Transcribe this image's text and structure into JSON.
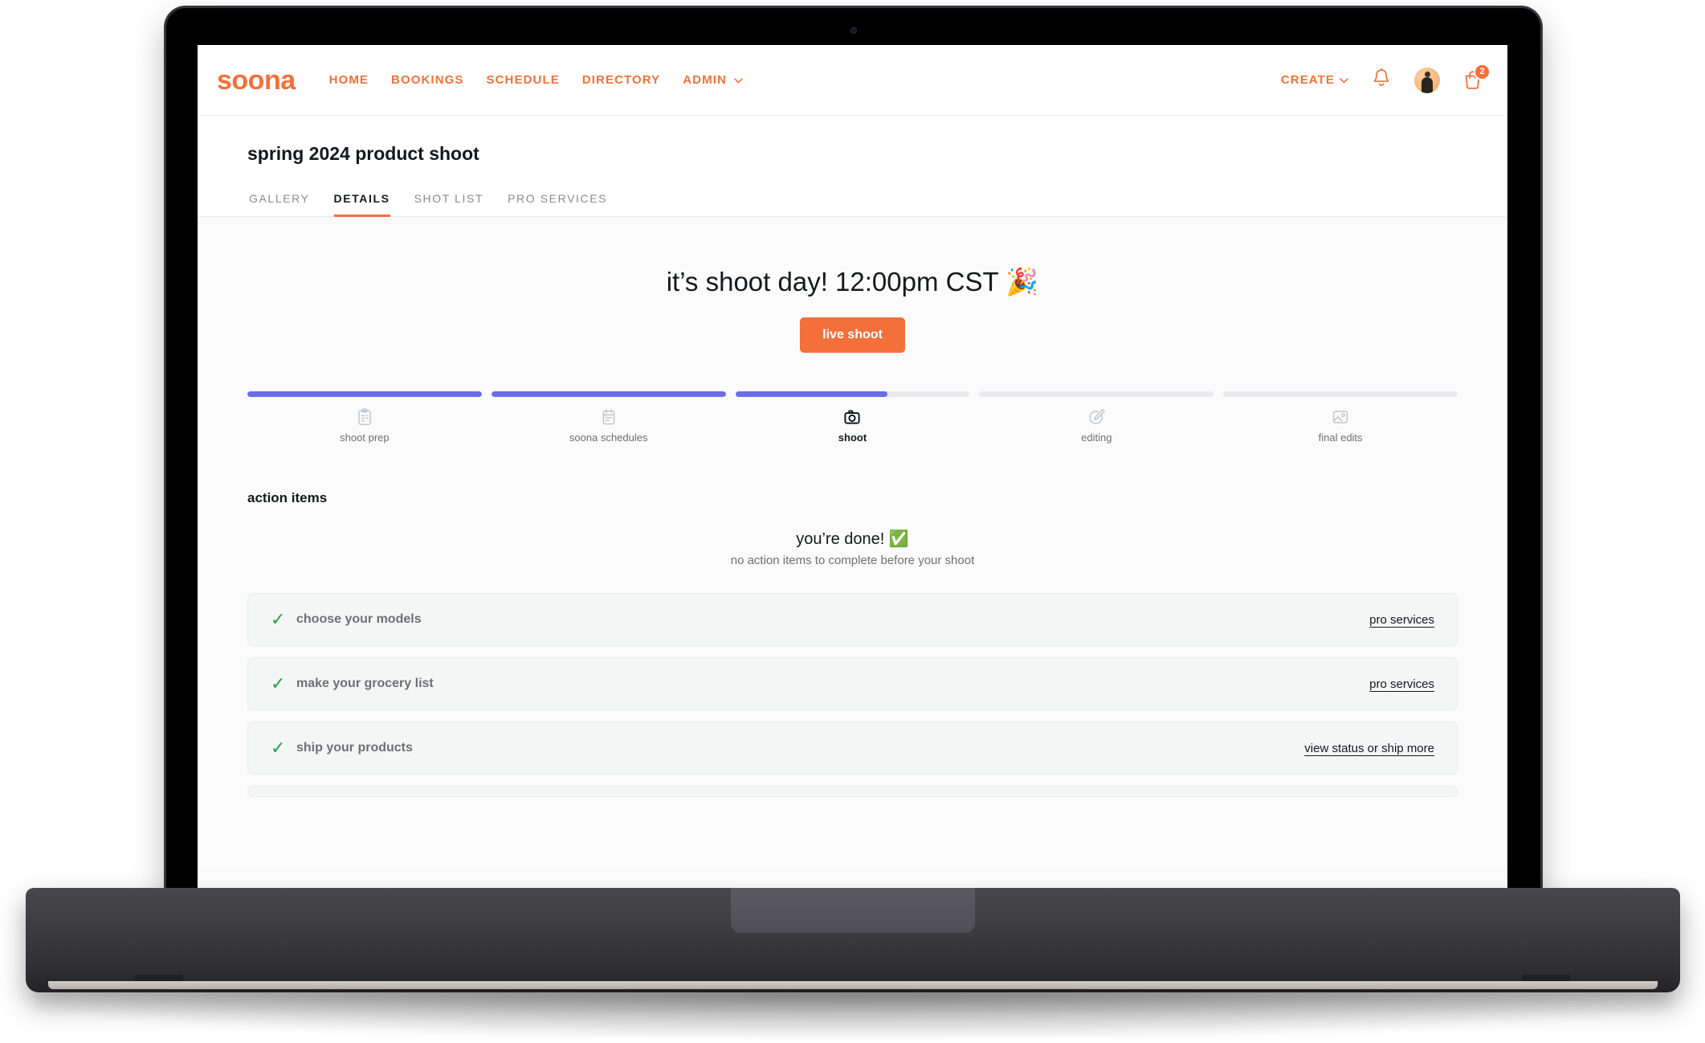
{
  "nav": {
    "logo": "soona",
    "links": [
      {
        "label": "HOME",
        "caret": ""
      },
      {
        "label": "BOOKINGS",
        "caret": ""
      },
      {
        "label": "SCHEDULE",
        "caret": ""
      },
      {
        "label": "DIRECTORY",
        "caret": ""
      },
      {
        "label": "ADMIN",
        "caret": "⌄"
      }
    ],
    "create_label": "CREATE",
    "create_caret": "⌄",
    "cart_badge": "2",
    "accent_color": "#f3703a"
  },
  "header": {
    "title": "spring 2024 product shoot",
    "tabs": [
      {
        "label": "GALLERY",
        "active": false
      },
      {
        "label": "DETAILS",
        "active": true
      },
      {
        "label": "SHOT LIST",
        "active": false
      },
      {
        "label": "PRO SERVICES",
        "active": false
      }
    ]
  },
  "hero": {
    "title": "it’s shoot day! 12:00pm CST 🎉",
    "button_label": "live shoot"
  },
  "stepper": {
    "progress_color": "#6a6ce8",
    "track_color": "#eaeaec",
    "steps": [
      {
        "label": "shoot prep",
        "icon": "clipboard-icon",
        "progress": 100,
        "active": false
      },
      {
        "label": "soona schedules",
        "icon": "calendar-icon",
        "progress": 100,
        "active": false
      },
      {
        "label": "shoot",
        "icon": "camera-icon",
        "progress": 65,
        "active": true
      },
      {
        "label": "editing",
        "icon": "edit-pencil-icon",
        "progress": 0,
        "active": false
      },
      {
        "label": "final edits",
        "icon": "image-icon",
        "progress": 0,
        "active": false
      }
    ]
  },
  "action_items": {
    "section_title": "action items",
    "done_title": "you’re done! ✅",
    "done_subtitle": "no action items to complete before your shoot",
    "check_glyph": "✓",
    "rows": [
      {
        "label": "choose your models",
        "link": "pro services",
        "clipped": false
      },
      {
        "label": "make your grocery list",
        "link": "pro services",
        "clipped": false
      },
      {
        "label": "ship your products",
        "link": "view status or ship more",
        "clipped": false
      },
      {
        "label": "",
        "link": "",
        "clipped": true
      }
    ]
  }
}
